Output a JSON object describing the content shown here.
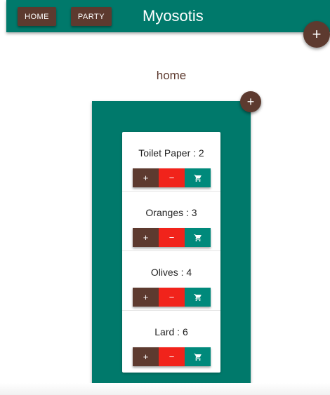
{
  "appbar": {
    "title": "Myosotis",
    "nav": [
      {
        "label": "HOME"
      },
      {
        "label": "PARTY"
      }
    ],
    "add_icon": "plus-icon",
    "add_label": "+"
  },
  "list": {
    "name": "home",
    "add_label": "+",
    "items": [
      {
        "label": "Toilet Paper : 2"
      },
      {
        "label": "Oranges : 3"
      },
      {
        "label": "Olives : 4"
      },
      {
        "label": "Lard : 6"
      }
    ],
    "controls": {
      "increment_label": "+",
      "decrement_label": "−",
      "cart_icon": "cart-icon"
    }
  },
  "colors": {
    "primary": "#00796b",
    "accent_brown": "#5d3a2f",
    "danger_red": "#f1231b",
    "cart_green": "#00897b"
  }
}
